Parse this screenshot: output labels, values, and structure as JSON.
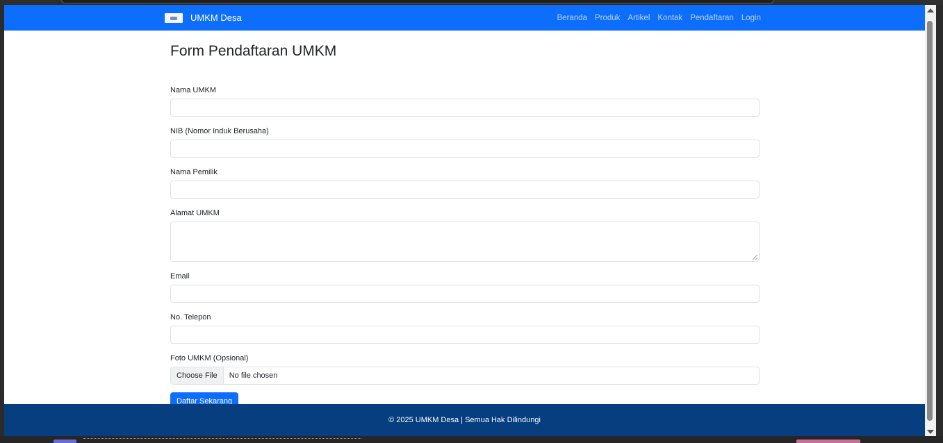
{
  "navbar": {
    "brand": "UMKM Desa",
    "links": [
      "Beranda",
      "Produk",
      "Artikel",
      "Kontak",
      "Pendaftaran",
      "Login"
    ]
  },
  "form": {
    "title": "Form Pendaftaran UMKM",
    "fields": {
      "nama_umkm": "Nama UMKM",
      "nib": "NIB (Nomor Induk Berusaha)",
      "nama_pemilik": "Nama Pemilik",
      "alamat": "Alamat UMKM",
      "email": "Email",
      "telepon": "No. Telepon",
      "foto": "Foto UMKM (Opsional)"
    },
    "file_button": "Choose File",
    "file_status": "No file chosen",
    "submit_label": "Daftar Sekarang"
  },
  "footer": {
    "text": "© 2025 UMKM Desa | Semua Hak Dilindungi"
  },
  "colors": {
    "primary": "#0d6efd",
    "footer": "#063e80"
  }
}
